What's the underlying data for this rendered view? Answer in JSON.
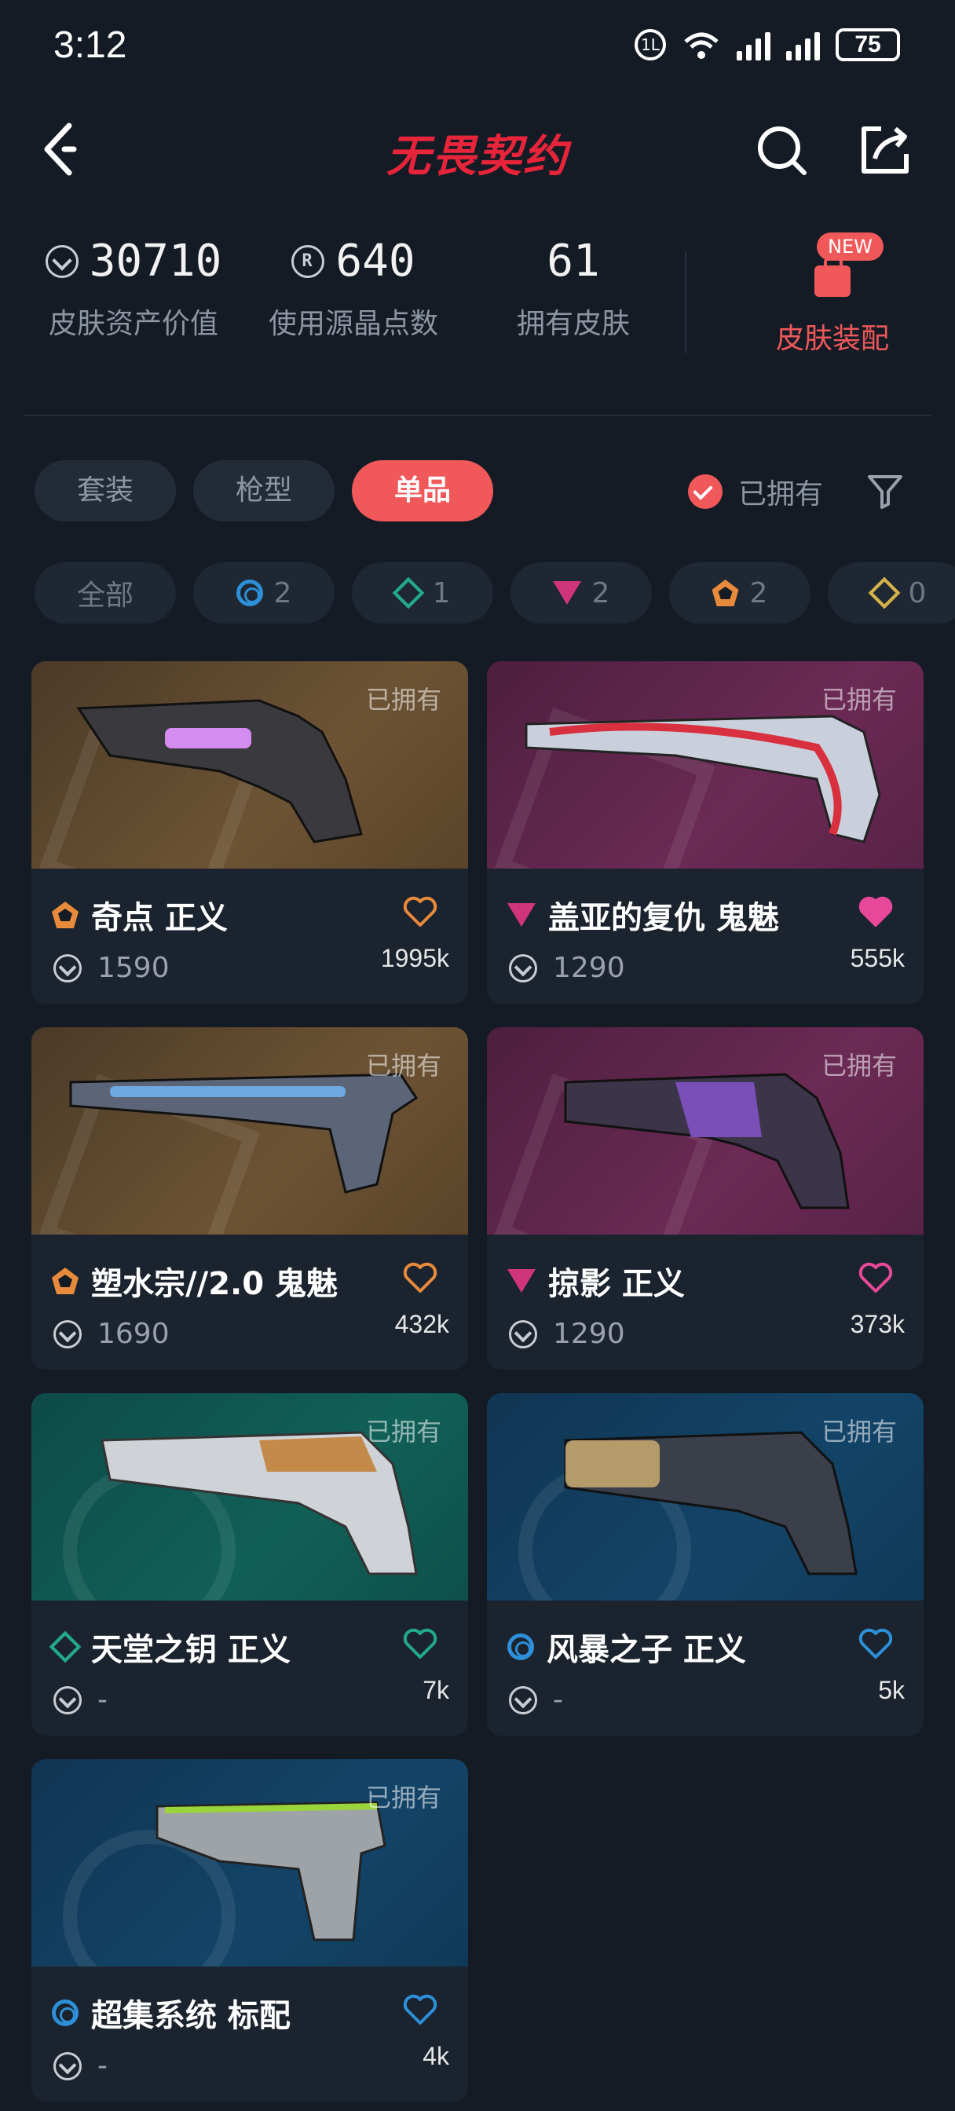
{
  "status_bar": {
    "time": "3:12",
    "battery": "75"
  },
  "header": {
    "title": "无畏契约"
  },
  "stats": {
    "asset_value": {
      "value": "30710",
      "label": "皮肤资产价值"
    },
    "radianite": {
      "value": "640",
      "label": "使用源晶点数"
    },
    "owned": {
      "value": "61",
      "label": "拥有皮肤"
    },
    "equip": {
      "label": "皮肤装配",
      "badge": "NEW"
    }
  },
  "tabs": [
    {
      "label": "套装",
      "active": false
    },
    {
      "label": "枪型",
      "active": false
    },
    {
      "label": "单品",
      "active": true
    }
  ],
  "owned_filter": {
    "label": "已拥有",
    "checked": true
  },
  "tiers": [
    {
      "label": "全部",
      "icon": ""
    },
    {
      "icon": "select-tier-icon",
      "count": "2"
    },
    {
      "icon": "deluxe-tier-icon",
      "count": "1"
    },
    {
      "icon": "premium-tier-icon",
      "count": "2"
    },
    {
      "icon": "ultra-tier-icon",
      "count": "2"
    },
    {
      "icon": "exclusive-tier-icon",
      "count": "0"
    }
  ],
  "cards": [
    {
      "name": "奇点 正义",
      "price": "1590",
      "likes": "1995k",
      "owned": "已拥有",
      "tier": "ultra",
      "liked": false,
      "heart_color": "#e88a3c"
    },
    {
      "name": "盖亚的复仇 鬼魅",
      "price": "1290",
      "likes": "555k",
      "owned": "已拥有",
      "tier": "premium",
      "liked": true,
      "heart_color": "#e8489a"
    },
    {
      "name": "塑水宗//2.0 鬼魅",
      "price": "1690",
      "likes": "432k",
      "owned": "已拥有",
      "tier": "ultra",
      "liked": false,
      "heart_color": "#e88a3c"
    },
    {
      "name": "掠影 正义",
      "price": "1290",
      "likes": "373k",
      "owned": "已拥有",
      "tier": "premium",
      "liked": false,
      "heart_color": "#e8489a"
    },
    {
      "name": "天堂之钥 正义",
      "price": "-",
      "likes": "7k",
      "owned": "已拥有",
      "tier": "deluxe",
      "liked": false,
      "heart_color": "#22a98a"
    },
    {
      "name": "风暴之子 正义",
      "price": "-",
      "likes": "5k",
      "owned": "已拥有",
      "tier": "select",
      "liked": false,
      "heart_color": "#2d8fd8"
    },
    {
      "name": "超集系统 标配",
      "price": "-",
      "likes": "4k",
      "owned": "已拥有",
      "tier": "select",
      "liked": false,
      "heart_color": "#2d8fd8"
    }
  ]
}
